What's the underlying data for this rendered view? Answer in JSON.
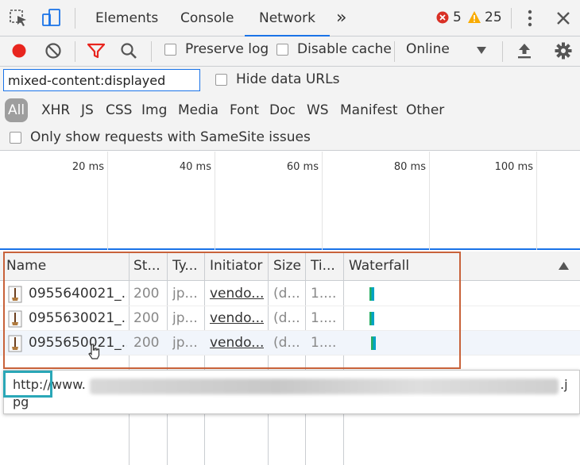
{
  "tabs": [
    "Elements",
    "Console",
    "Network"
  ],
  "more_tabs_glyph": "»",
  "errors": {
    "count": "5",
    "color": "#d93025"
  },
  "warnings": {
    "count": "25",
    "color": "#f9ab00"
  },
  "toolbar": {
    "preserve_log": "Preserve log",
    "disable_cache": "Disable cache",
    "throttle": "Online"
  },
  "filter": {
    "value": "mixed-content:displayed",
    "hide_data_urls": "Hide data URLs",
    "types": [
      "All",
      "XHR",
      "JS",
      "CSS",
      "Img",
      "Media",
      "Font",
      "Doc",
      "WS",
      "Manifest",
      "Other"
    ],
    "samesite": "Only show requests with SameSite issues"
  },
  "overview": {
    "ticks": [
      "20 ms",
      "40 ms",
      "60 ms",
      "80 ms",
      "100 ms"
    ]
  },
  "table": {
    "columns": [
      "Name",
      "St...",
      "Ty...",
      "Initiator",
      "Size",
      "Ti...",
      "Waterfall"
    ],
    "rows": [
      {
        "name": "0955640021_...",
        "status": "200",
        "type": "jp...",
        "initiator": "vendo...",
        "size": "(d...",
        "time": "1...."
      },
      {
        "name": "0955630021_...",
        "status": "200",
        "type": "jp...",
        "initiator": "vendo...",
        "size": "(d...",
        "time": "1...."
      },
      {
        "name": "0955650021_...",
        "status": "200",
        "type": "jp...",
        "initiator": "vendo...",
        "size": "(d...",
        "time": "1...."
      }
    ]
  },
  "tooltip": {
    "line1_start": "http://www.",
    "line1_end": ".j",
    "line2": "pg"
  },
  "colors": {
    "accent": "#1a73e8",
    "record": "#e8251e",
    "highlight_red": "#c8623a",
    "highlight_teal": "#2aa7b7"
  }
}
